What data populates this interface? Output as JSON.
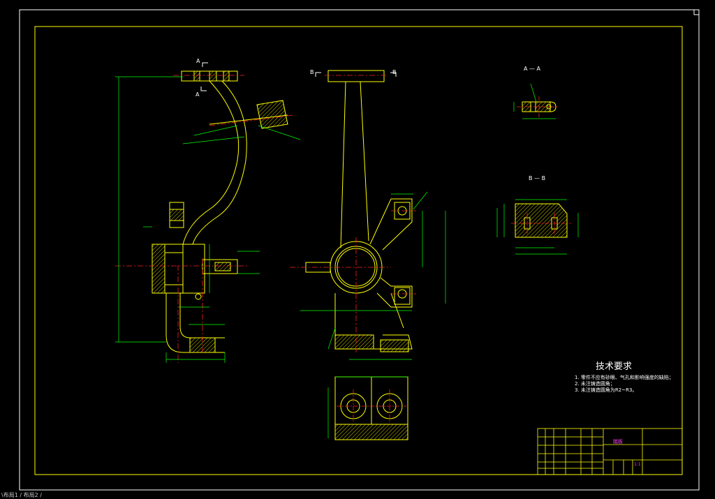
{
  "drawing": {
    "section_a_label": "A — A",
    "section_b_label": "B — B",
    "cut_a": "A",
    "cut_b": "B",
    "tech_title": "技术要求",
    "tech_lines": [
      "1. 零件不应有砂眼、气孔和影响强度的缺陷；",
      "2. 未注铸造圆角；",
      "3. 未注铸造圆角为R2~R3。"
    ],
    "title_block": {
      "part_name": "踏板",
      "scale": "1:1"
    },
    "status_bar": "\\布局1 / 布局2 /"
  },
  "colors": {
    "outline": "#ffff00",
    "frame": "#ffffff",
    "center": "#ff2020",
    "dimension": "#00ff00",
    "text": "#ff40ff"
  }
}
